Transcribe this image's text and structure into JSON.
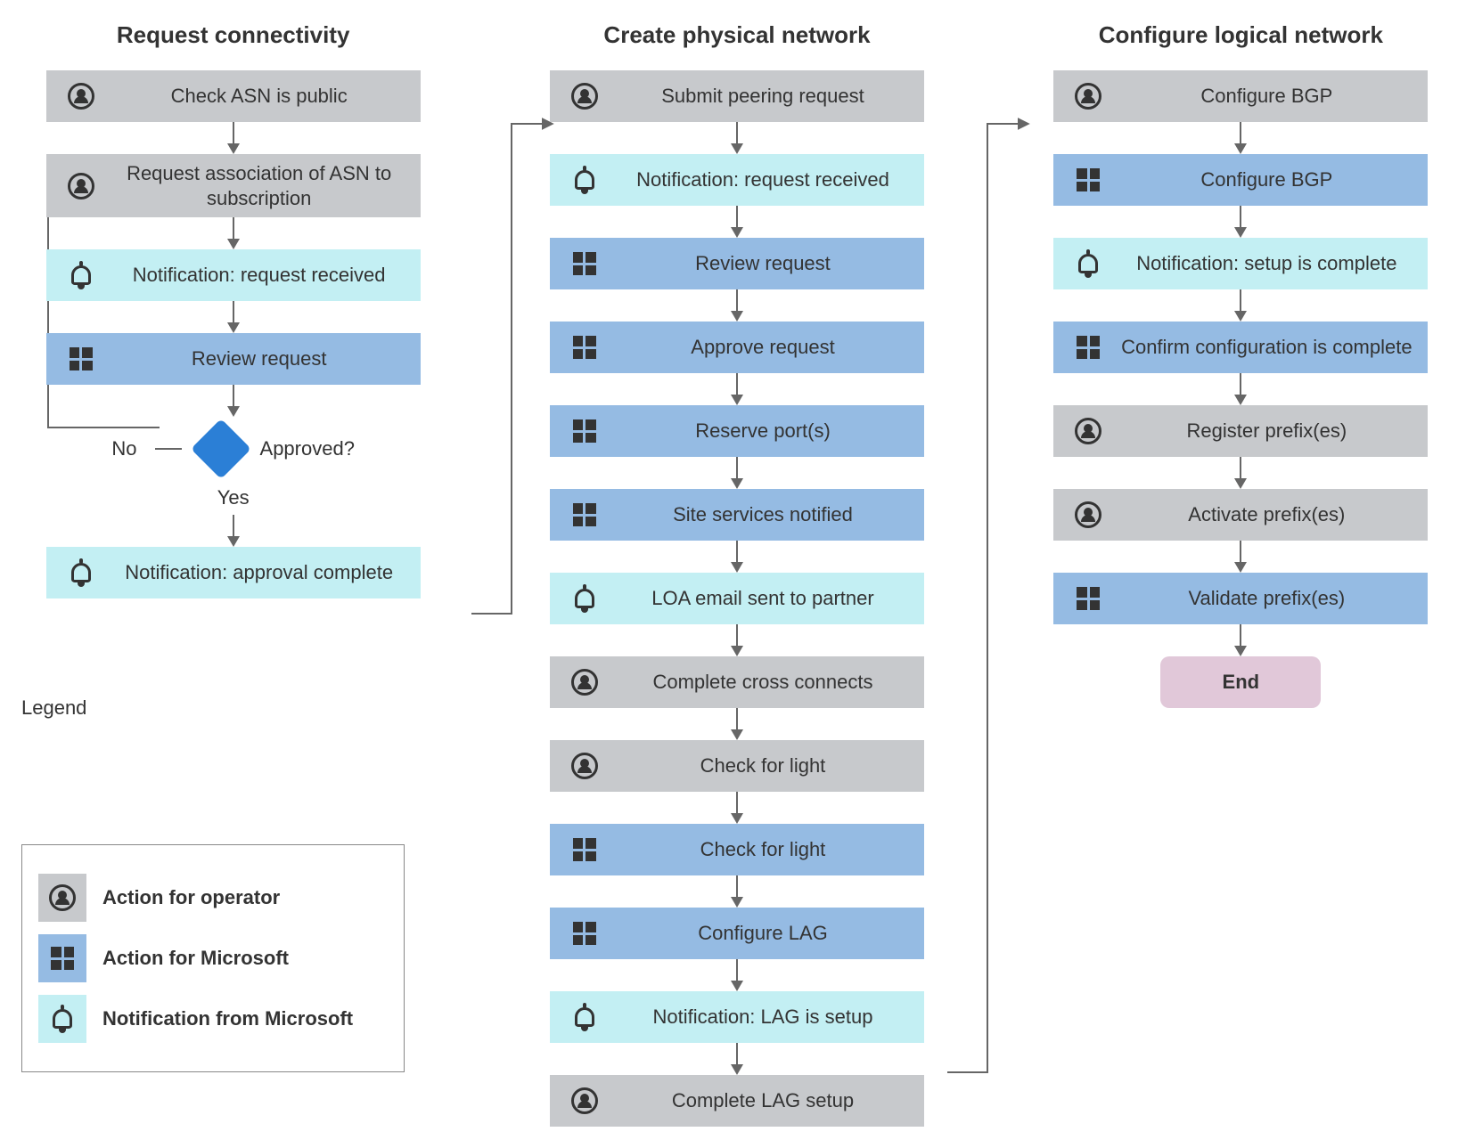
{
  "columns": {
    "col1": {
      "title": "Request connectivity"
    },
    "col2": {
      "title": "Create physical network"
    },
    "col3": {
      "title": "Configure logical network"
    }
  },
  "col1_nodes": {
    "n0": "Check ASN is public",
    "n1": "Request association of ASN to subscription",
    "n2": "Notification: request received",
    "n3": "Review request",
    "n4_no": "No",
    "n4_q": "Approved?",
    "n4_yes": "Yes",
    "n5": "Notification: approval complete"
  },
  "col2_nodes": {
    "n0": "Submit peering request",
    "n1": "Notification: request received",
    "n2": "Review request",
    "n3": "Approve request",
    "n4": "Reserve port(s)",
    "n5": "Site services notified",
    "n6": "LOA email sent to partner",
    "n7": "Complete cross connects",
    "n8": "Check for light",
    "n9": "Check for light",
    "n10": "Configure LAG",
    "n11": "Notification: LAG is setup",
    "n12": "Complete LAG setup"
  },
  "col3_nodes": {
    "n0": "Configure BGP",
    "n1": "Configure BGP",
    "n2": "Notification: setup is complete",
    "n3": "Confirm configuration is complete",
    "n4": "Register prefix(es)",
    "n5": "Activate prefix(es)",
    "n6": "Validate prefix(es)",
    "end": "End"
  },
  "legend": {
    "title": "Legend",
    "operator": "Action for operator",
    "microsoft": "Action for Microsoft",
    "notify": "Notification from Microsoft"
  },
  "colors": {
    "operator": "#c7c9cc",
    "microsoft": "#95bbe3",
    "notify": "#c3eff3",
    "end": "#e1c8d9",
    "decision": "#2b7fd6"
  }
}
